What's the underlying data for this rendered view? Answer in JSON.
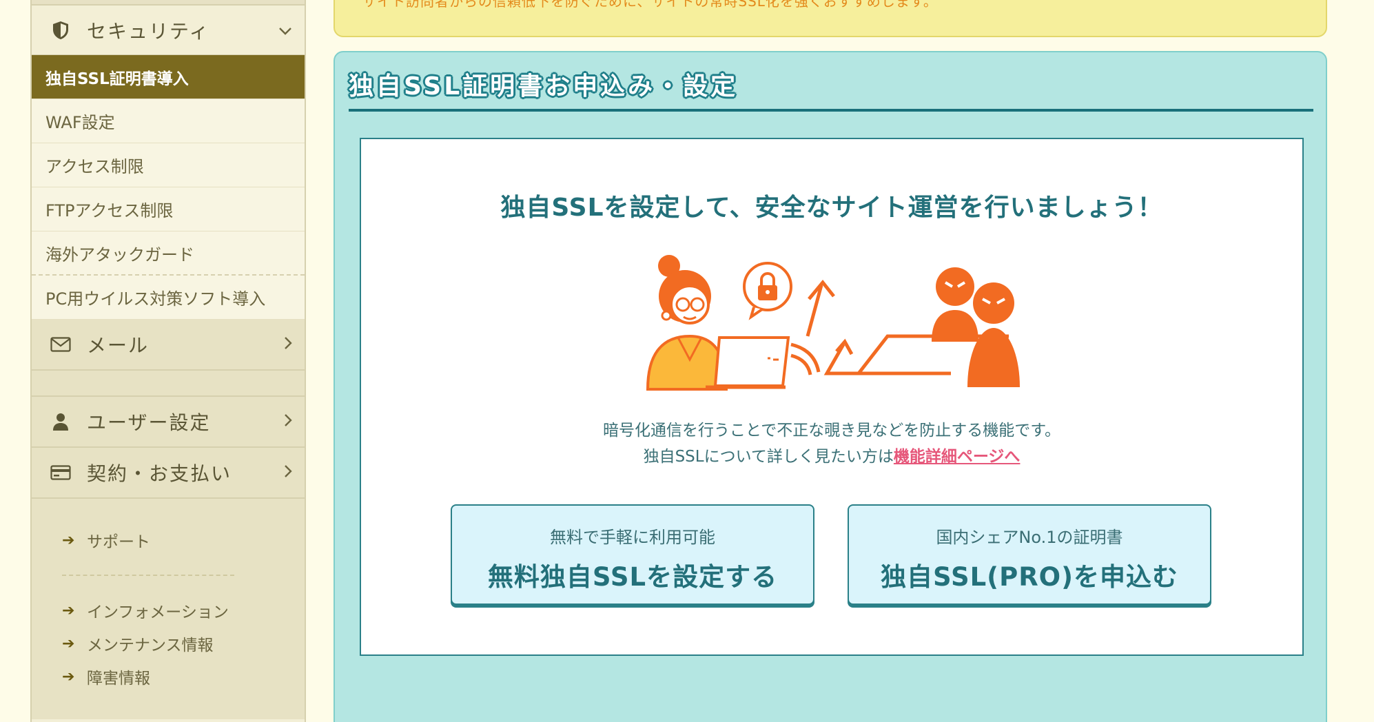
{
  "notice": {
    "text": "サイト訪問者からの信頼低下を防ぐために、サイトの常時SSL化を強くおすすめします。"
  },
  "sidebar": {
    "security": {
      "label": "セキュリティ",
      "icon": "shield-icon"
    },
    "items": [
      {
        "label": "独自SSL証明書導入",
        "active": true
      },
      {
        "label": "WAF設定"
      },
      {
        "label": "アクセス制限"
      },
      {
        "label": "FTPアクセス制限"
      },
      {
        "label": "海外アタックガード"
      },
      {
        "label": "PC用ウイルス対策ソフト導入"
      }
    ],
    "categories": [
      {
        "label": "メール",
        "icon": "mail-icon"
      },
      {
        "label": "ユーザー設定",
        "icon": "user-icon"
      },
      {
        "label": "契約・お支払い",
        "icon": "credit-card-icon"
      }
    ],
    "links": [
      {
        "label": "サポート"
      },
      {
        "label": "インフォメーション"
      },
      {
        "label": "メンテナンス情報"
      },
      {
        "label": "障害情報"
      }
    ]
  },
  "panel": {
    "title": "独自SSL証明書お申込み・設定",
    "headline": "独自SSLを設定して、安全なサイト運営を行いましょう！",
    "desc_line1": "暗号化通信を行うことで不正な覗き見などを防止する機能です。",
    "desc_line2_prefix": "独自SSLについて詳しく見たい方は",
    "desc_link": "機能詳細ページへ",
    "buttons": {
      "free": {
        "sub": "無料で手軽に利用可能",
        "main": "無料独自SSLを設定する"
      },
      "pro": {
        "sub": "国内シェアNo.1の証明書",
        "main": "独自SSL(PRO)を申込む"
      }
    }
  },
  "colors": {
    "accent_teal": "#23707a",
    "panel_bg": "#b4e6e2",
    "active_item": "#7b6a1f",
    "link_pink": "#e6577a",
    "illustration_orange": "#f26b22"
  }
}
